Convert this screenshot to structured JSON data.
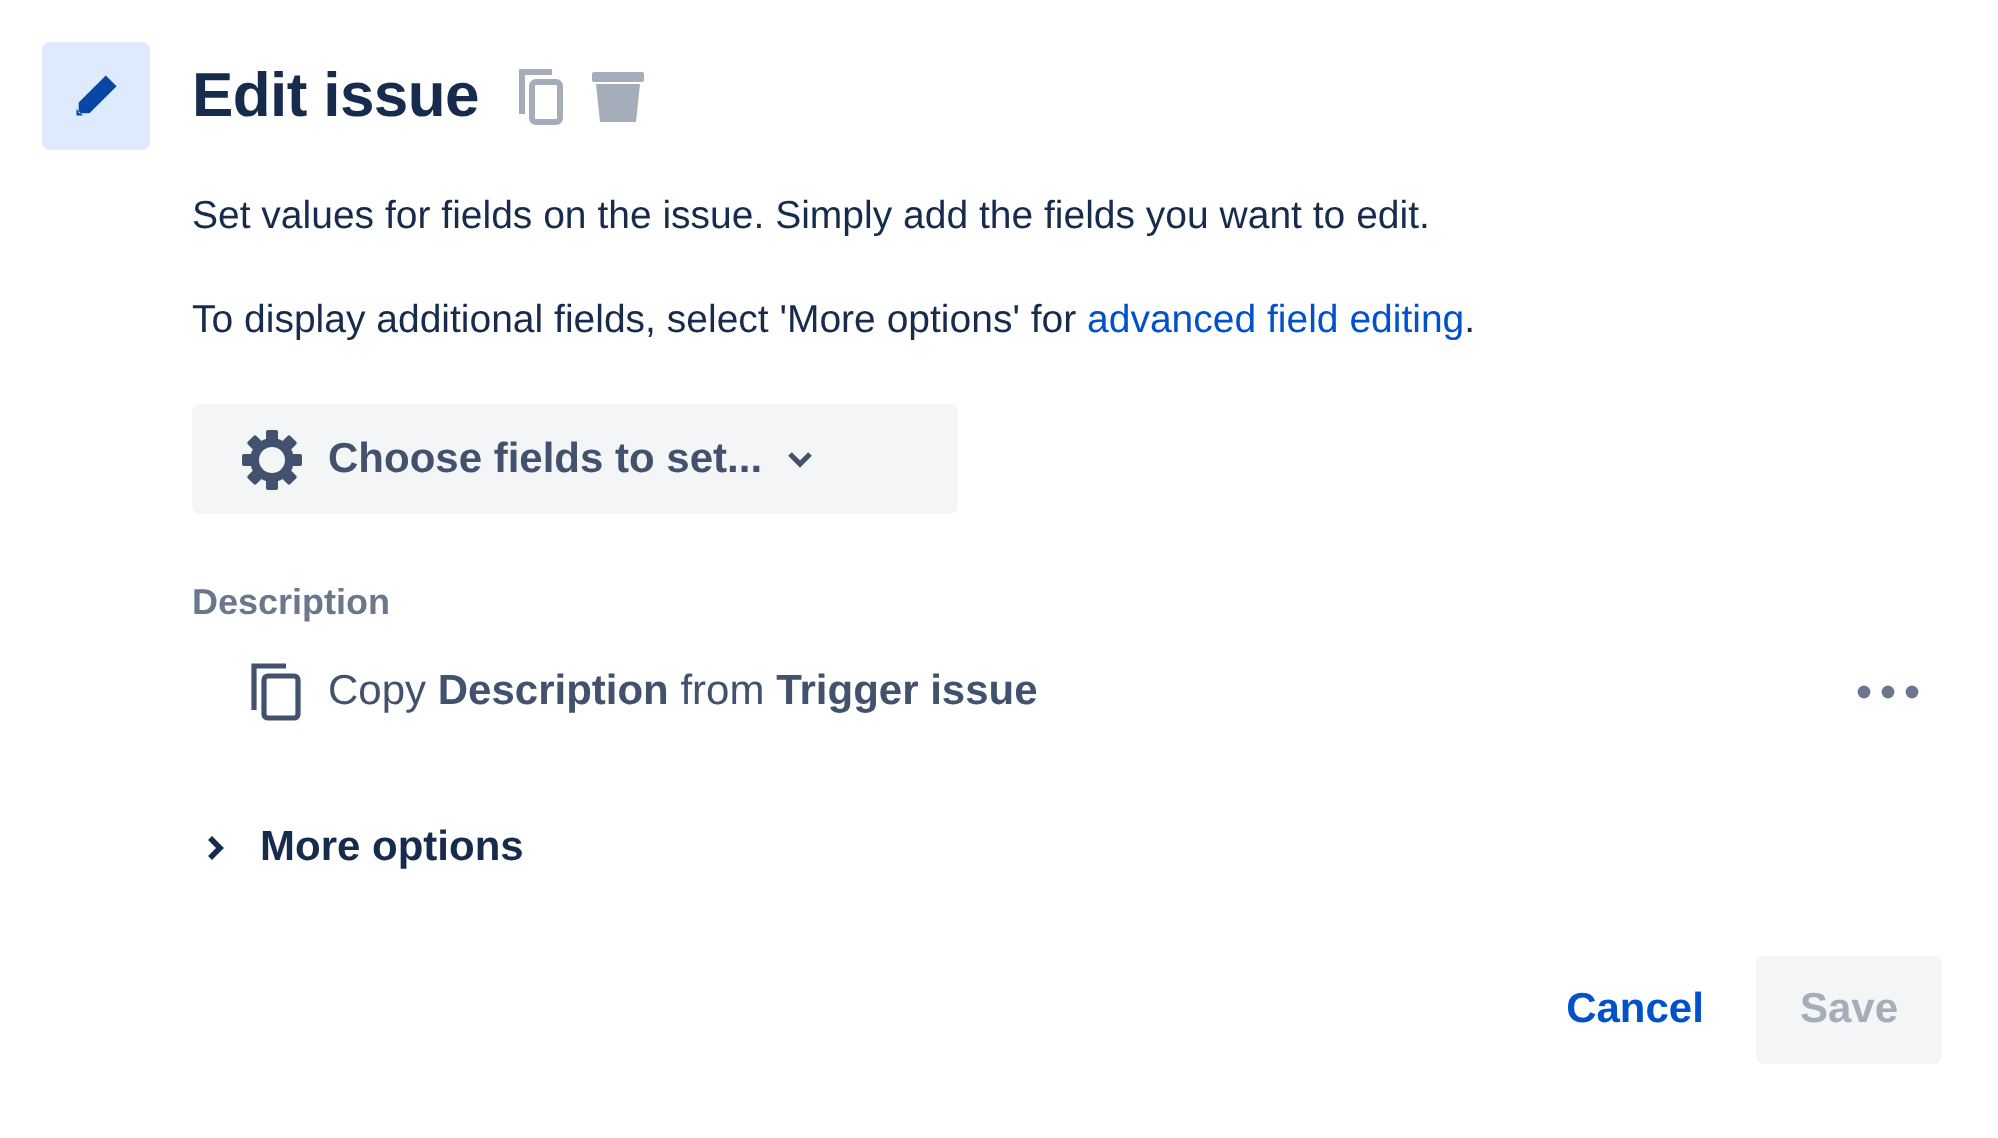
{
  "header": {
    "title": "Edit issue"
  },
  "intro": [
    "Set values for fields on the issue. Simply add the fields you want to edit."
  ],
  "advanced_note": {
    "text": "To display additional fields, select 'More options' for",
    "link": "advanced field editing",
    "end": "."
  },
  "choose_button": {
    "label": "Choose fields to set..."
  },
  "fields": [
    {
      "label": "Description",
      "action": "Copy **Description** from **Trigger issue**"
    }
  ],
  "more_options": {
    "label": "More options",
    "expanded": false
  },
  "buttons": [
    {
      "label": "Cancel",
      "kind": "link",
      "disabled": false
    },
    {
      "label": "Save",
      "kind": "primary",
      "disabled": true
    }
  ]
}
